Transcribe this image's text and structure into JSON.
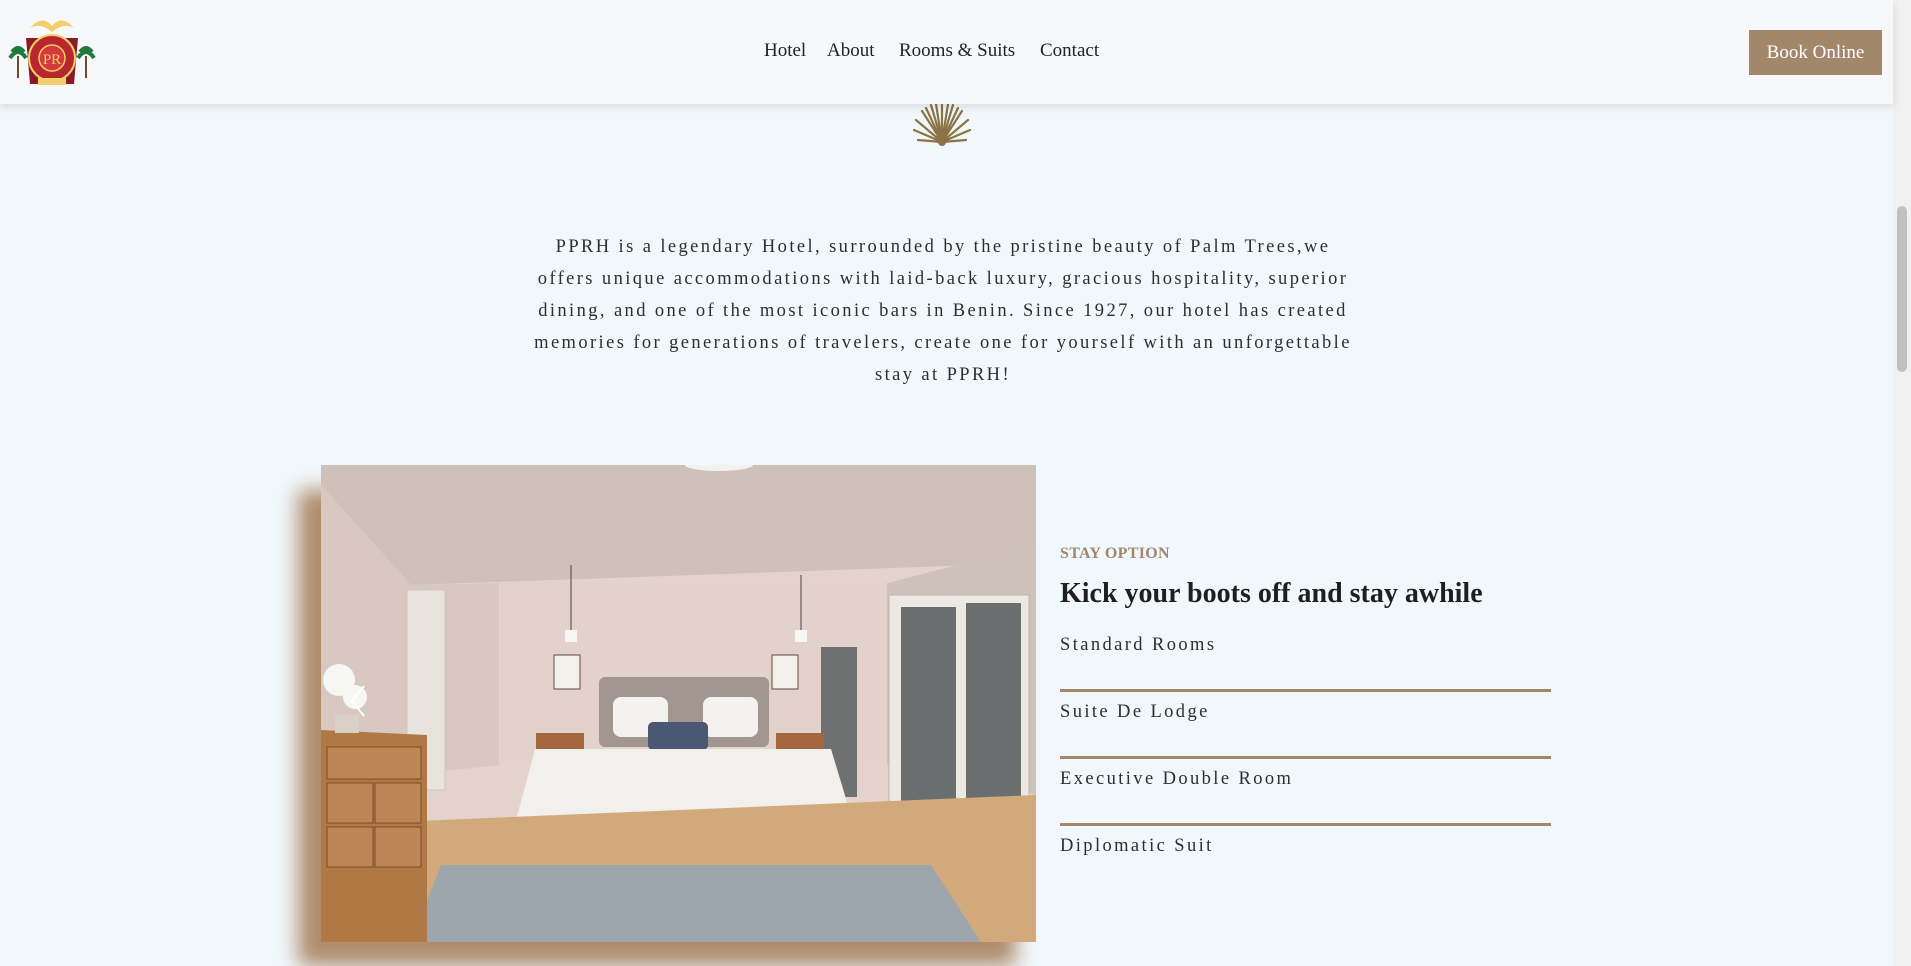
{
  "nav": {
    "logo": {
      "alt_text": "PPRH logo",
      "monogram": "PR",
      "ring_text": "PRESTIGE PALM HOTEL"
    },
    "links": [
      "Hotel",
      "About",
      "Rooms & Suits",
      "Contact"
    ],
    "book_label": "Book Online"
  },
  "intro": {
    "ornament": "palm-leaf-icon",
    "text": "PPRH is a legendary Hotel, surrounded by the pristine beauty of Palm Trees,we offers unique accommodations with laid-back luxury, gracious hospitality, superior dining, and one of the most iconic bars in Benin. Since 1927, our hotel has created memories for generations of travelers, create one for yourself with an unforgettable stay at PPRH!"
  },
  "stay": {
    "eyebrow": "STAY OPTION",
    "heading": "Kick your boots off and stay awhile",
    "rooms": [
      "Standard Rooms",
      "Suite De Lodge",
      "Executive Double Room",
      "Diplomatic Suit"
    ]
  },
  "colors": {
    "accent": "#a3876b",
    "background": "#f1f8fc",
    "header": "#f6f8fa"
  }
}
